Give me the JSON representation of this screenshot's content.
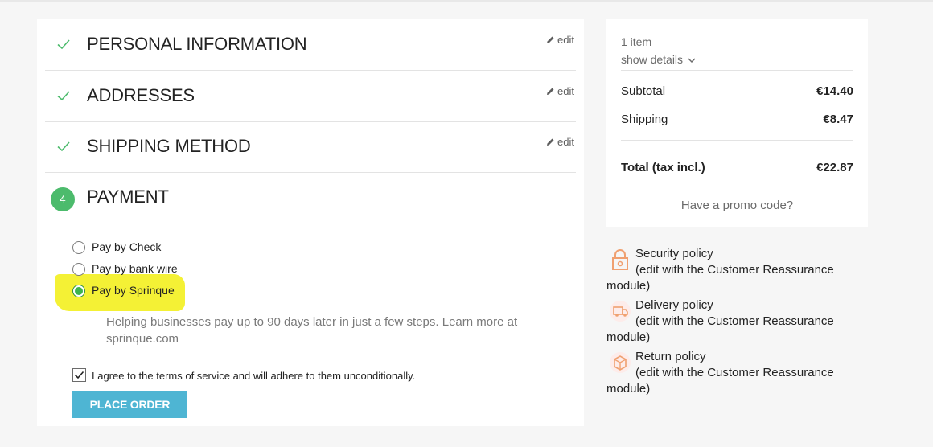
{
  "steps": [
    {
      "label": "PERSONAL INFORMATION",
      "edit": "edit"
    },
    {
      "label": "ADDRESSES",
      "edit": "edit"
    },
    {
      "label": "SHIPPING METHOD",
      "edit": "edit"
    },
    {
      "label": "PAYMENT",
      "number": "4"
    }
  ],
  "payment": {
    "options": [
      {
        "label": "Pay by Check",
        "selected": false
      },
      {
        "label": "Pay by bank wire",
        "selected": false
      },
      {
        "label": "Pay by Sprinque",
        "selected": true
      }
    ],
    "description": "Helping businesses pay up to 90 days later in just a few steps. Learn more at sprinque.com",
    "terms_label": "I agree to the terms of service and will adhere to them unconditionally.",
    "terms_checked": true,
    "place_order": "PLACE ORDER"
  },
  "summary": {
    "items": "1 item",
    "show_details": "show details",
    "subtotal_label": "Subtotal",
    "subtotal_value": "€14.40",
    "shipping_label": "Shipping",
    "shipping_value": "€8.47",
    "total_label": "Total (tax incl.)",
    "total_value": "€22.87",
    "promo": "Have a promo code?"
  },
  "reassurance": [
    {
      "title": "Security policy",
      "note": "(edit with the Customer Reassurance",
      "tail": "module)",
      "icon": "lock-icon"
    },
    {
      "title": "Delivery policy",
      "note": "(edit with the Customer Reassurance",
      "tail": "module)",
      "icon": "truck-icon"
    },
    {
      "title": "Return policy",
      "note": "(edit with the Customer Reassurance",
      "tail": "module)",
      "icon": "return-box-icon"
    }
  ],
  "colors": {
    "accent_green": "#4cbb6c",
    "button_blue": "#4eb5d3",
    "highlight_yellow": "#f3f02a",
    "icon_orange": "#f0a070"
  }
}
